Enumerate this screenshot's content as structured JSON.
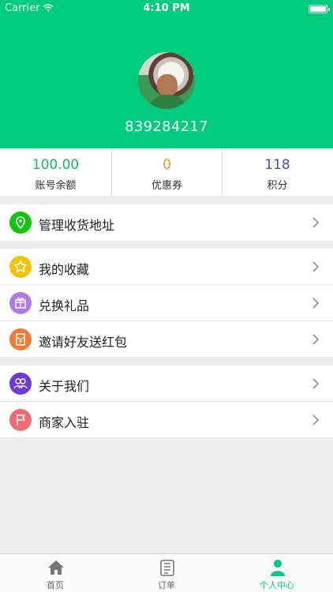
{
  "status_bar": {
    "carrier": "Carrier",
    "time": "4:10 PM"
  },
  "profile": {
    "user_id": "839284217"
  },
  "stats": [
    {
      "value": "100.00",
      "label": "账号余额",
      "color": "#18b66f"
    },
    {
      "value": "0",
      "label": "优惠券",
      "color": "#e89a24"
    },
    {
      "value": "118",
      "label": "积分",
      "color": "#4f529b"
    }
  ],
  "menu": {
    "address": {
      "label": "管理收货地址",
      "icon": "location-pin-icon",
      "color": "#12c50b"
    },
    "favorites": {
      "label": "我的收藏",
      "icon": "star-icon",
      "color": "#f5c400"
    },
    "gifts": {
      "label": "兑换礼品",
      "icon": "gift-icon",
      "color": "#b07ae6"
    },
    "invite": {
      "label": "邀请好友送红包",
      "icon": "red-envelope-icon",
      "color": "#f07c35"
    },
    "about": {
      "label": "关于我们",
      "icon": "people-icon",
      "color": "#6f38dc"
    },
    "merchant": {
      "label": "商家入驻",
      "icon": "flag-icon",
      "color": "#ef6b73"
    }
  },
  "tabbar": {
    "home": {
      "label": "首页",
      "icon": "home-icon"
    },
    "orders": {
      "label": "订单",
      "icon": "document-icon"
    },
    "profile": {
      "label": "个人中心",
      "icon": "person-icon"
    }
  },
  "accent_color": "#00cc7e"
}
